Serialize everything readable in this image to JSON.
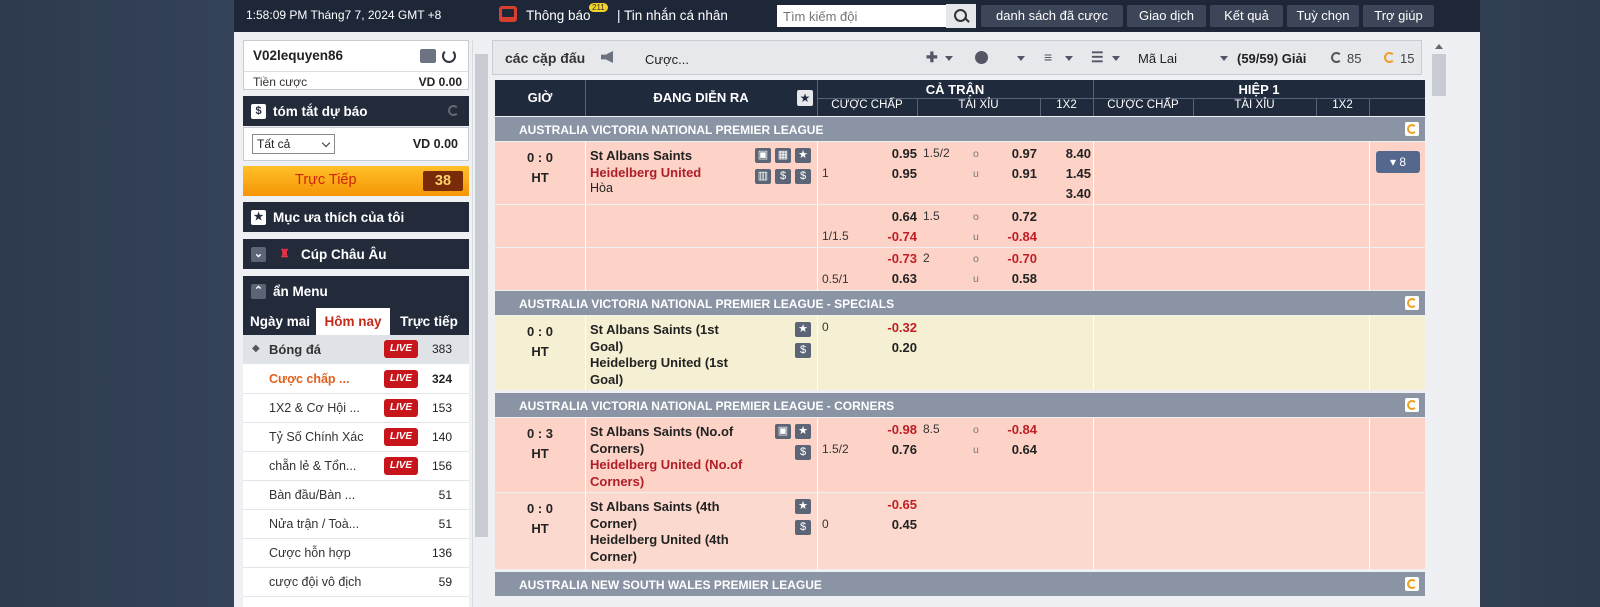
{
  "topbar": {
    "clock": "1:58:09 PM Tháng7 7, 2024 GMT +8",
    "notice": "Thông báo",
    "notice_badge": "211",
    "messages": "| Tin nhắn cá nhân",
    "search_placeholder": "Tìm kiếm đội",
    "buttons": [
      "danh sách đã cược",
      "Giao dịch",
      "Kết quả",
      "Tuỳ chọn",
      "Trợ giúp"
    ]
  },
  "user": {
    "name": "V02lequyen86",
    "bet_label": "Tiền cược",
    "bet_value": "VD  0.00"
  },
  "summary": {
    "title": "tóm tắt dự báo",
    "select": "Tất cả",
    "value": "VD 0.00"
  },
  "live": {
    "label": "Trực Tiếp",
    "count": "38"
  },
  "favorites": {
    "title": "Mục ưa thích của tôi"
  },
  "euro": {
    "title": "Cúp Châu Âu"
  },
  "hidemenu": {
    "title": "ẩn Menu"
  },
  "tabs": [
    "Ngày mai",
    "Hôm nay",
    "Trực tiếp"
  ],
  "menu": [
    {
      "label": "Bóng đá",
      "live": "LIVE",
      "count": "383"
    },
    {
      "label": "Cược chấp ...",
      "live": "LIVE",
      "count": "324"
    },
    {
      "label": "1X2 & Cơ Hội ...",
      "live": "LIVE",
      "count": "153"
    },
    {
      "label": "Tỷ Số Chính Xác",
      "live": "LIVE",
      "count": "140"
    },
    {
      "label": "chẵn lẻ & Tổn...",
      "live": "LIVE",
      "count": "156"
    },
    {
      "label": "Bàn đầu/Bàn ...",
      "count": "51"
    },
    {
      "label": "Nửa trận / Toà...",
      "count": "51"
    },
    {
      "label": "Cược hỗn hợp",
      "count": "136"
    },
    {
      "label": "cược đội vô địch",
      "count": "59"
    }
  ],
  "main": {
    "title": "các cặp đấu",
    "bet_type": "Cược...",
    "odds_format": "Mã Lai",
    "league_count": "(59/59) Giải",
    "refresh1": "85",
    "refresh2": "15"
  },
  "table_head": {
    "time": "GIỜ",
    "live": "ĐANG DIỄN RA",
    "full": "CẢ TRẬN",
    "half": "HIỆP 1",
    "hdp": "CƯỢC CHẤP",
    "ou": "TÀI XỈU",
    "x12": "1X2"
  },
  "leagues": [
    "AUSTRALIA VICTORIA NATIONAL PREMIER LEAGUE",
    "AUSTRALIA VICTORIA NATIONAL PREMIER LEAGUE - SPECIALS",
    "AUSTRALIA VICTORIA NATIONAL PREMIER LEAGUE - CORNERS",
    "AUSTRALIA NEW SOUTH WALES PREMIER LEAGUE"
  ],
  "match1": {
    "score": "0 : 0",
    "state": "HT",
    "home": "St Albans Saints",
    "away": "Heidelberg United",
    "draw": "Hòa",
    "hdp_line": "1",
    "h1": "0.95",
    "h2": "0.95",
    "ou_line": "1.5/2",
    "o": "o",
    "u": "u",
    "ou1": "0.97",
    "ou2": "0.91",
    "x1": "8.40",
    "x2": "1.45",
    "x3": "3.40",
    "more": "▾ 8",
    "r2_line": "1/1.5",
    "r2_h1": "0.64",
    "r2_h2": "-0.74",
    "r2_ou_line": "1.5",
    "r2_ou1": "0.72",
    "r2_ou2": "-0.84",
    "r3_line": "0.5/1",
    "r3_h1": "-0.73",
    "r3_h2": "0.63",
    "r3_ou_line": "2",
    "r3_ou1": "-0.70",
    "r3_ou2": "0.58"
  },
  "match2": {
    "score": "0 : 0",
    "state": "HT",
    "home": "St Albans Saints (1st Goal)",
    "away": "Heidelberg United (1st Goal)",
    "line": "0",
    "h1": "-0.32",
    "h2": "0.20"
  },
  "match3": {
    "score": "0 : 3",
    "state": "HT",
    "home": "St Albans Saints (No.of Corners)",
    "away": "Heidelberg United (No.of Corners)",
    "line": "1.5/2",
    "h1": "-0.98",
    "h2": "0.76",
    "ou_line": "8.5",
    "ou1": "-0.84",
    "ou2": "0.64"
  },
  "match4": {
    "score": "0 : 0",
    "state": "HT",
    "home": "St Albans Saints (4th Corner)",
    "away": "Heidelberg United (4th Corner)",
    "line": "0",
    "h1": "-0.65",
    "h2": "0.45"
  }
}
